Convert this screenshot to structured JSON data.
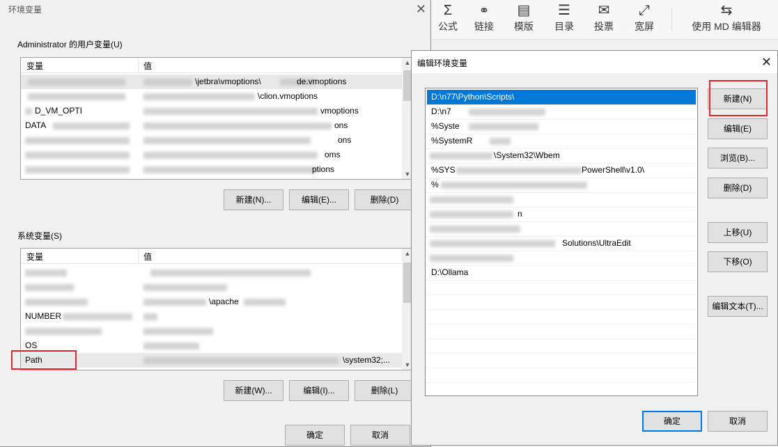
{
  "toolbar": {
    "items": [
      {
        "label": "公式",
        "icon": "sigma-icon",
        "glyph": "Σ"
      },
      {
        "label": "链接",
        "icon": "link-icon",
        "glyph": "🔗"
      },
      {
        "label": "模版",
        "icon": "template-icon",
        "glyph": "▤"
      },
      {
        "label": "目录",
        "icon": "toc-icon",
        "glyph": "☰"
      },
      {
        "label": "投票",
        "icon": "vote-icon",
        "glyph": "✉"
      },
      {
        "label": "宽屏",
        "icon": "widescreen-icon",
        "glyph": "⤢"
      },
      {
        "label": "使用 MD 编辑器",
        "icon": "md-editor-icon",
        "glyph": "⇆"
      }
    ]
  },
  "env_dialog": {
    "title": "环境变量",
    "close": "✕",
    "user_group_label": "Administrator 的用户变量(U)",
    "col_var": "变量",
    "col_val": "值",
    "user_rows": [
      {
        "var": "",
        "val": "\\jetbra\\vmoptions\\appcode.vmoptions",
        "val_prefix": "",
        "val_suffix": "\\jetbra\\vmoptions\\",
        "tail": "de.vmoptions"
      },
      {
        "var": "",
        "val": "",
        "tail": "\\clion.vmoptions"
      },
      {
        "var": "D_VM_OPTI",
        "val": "",
        "tail": "vmoptions"
      },
      {
        "var": "DATA",
        "val": "",
        "tail": "ons"
      },
      {
        "var": "",
        "val": "",
        "tail": "ons"
      },
      {
        "var": "",
        "val": "",
        "tail": "oms"
      },
      {
        "var": "",
        "val": "",
        "tail": "ptions"
      }
    ],
    "user_buttons": {
      "new": "新建(N)...",
      "edit": "编辑(E)...",
      "delete": "删除(D)"
    },
    "sys_group_label": "系统变量(S)",
    "sys_rows": [
      {
        "var": "",
        "val": ""
      },
      {
        "var": "",
        "val": ""
      },
      {
        "var": "",
        "val": "\\apache"
      },
      {
        "var": "NUMBER",
        "val": ""
      },
      {
        "var": "",
        "val": ""
      },
      {
        "var": "OS",
        "val": ""
      },
      {
        "var": "Path",
        "val": "\\system32;..."
      }
    ],
    "sys_buttons": {
      "new": "新建(W)...",
      "edit": "编辑(I)...",
      "delete": "删除(L)"
    },
    "ok": "确定",
    "cancel": "取消"
  },
  "edit_dialog": {
    "title": "编辑环境变量",
    "close": "✕",
    "entries": [
      "D:\\n77\\Python\\Scripts\\",
      "D:\\n7",
      "%Syste",
      "%SystemR",
      "\\System32\\Wbem",
      "%SYS",
      "%",
      "",
      "n",
      "",
      "Solutions\\UltraEdit",
      "",
      "D:\\Ollama"
    ],
    "entry_tails": {
      "5": "PowerShell\\v1.0\\",
      "0": ""
    },
    "buttons": {
      "new": "新建(N)",
      "edit": "编辑(E)",
      "browse": "浏览(B)...",
      "delete": "删除(D)",
      "up": "上移(U)",
      "down": "下移(O)",
      "edit_text": "编辑文本(T)...",
      "ok": "确定",
      "cancel": "取消"
    }
  }
}
